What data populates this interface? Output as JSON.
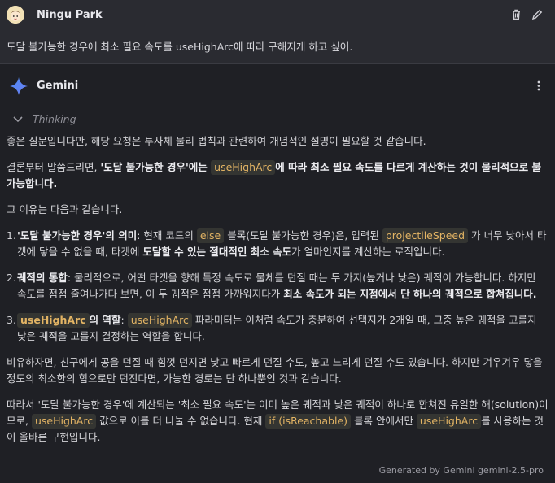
{
  "user": {
    "name": "Ningu Park",
    "message": "도달 불가능한 경우에 최소 필요 속도를 useHighArc에 따라 구해지게 하고 싶어.",
    "delete_icon": "trash-icon",
    "edit_icon": "pencil-icon"
  },
  "assistant": {
    "name": "Gemini",
    "thinking_label": "Thinking",
    "p1": "좋은 질문입니다만, 해당 요청은 투사체 물리 법칙과 관련하여 개념적인 설명이 필요할 것 같습니다.",
    "p2": {
      "t1": "결론부터 말씀드리면, ",
      "b1": "'도달 불가능한 경우'에는 ",
      "c1": "useHighArc",
      "b2": "에 따라 최소 필요 속도를 다르게 계산하는 것이 물리적으로 불가능합니다."
    },
    "p3": "그 이유는 다음과 같습니다.",
    "list": [
      {
        "num": "1.",
        "b1": "'도달 불가능한 경우'의 의미",
        "t1": ": 현재 코드의 ",
        "c1": "else",
        "t2": " 블록(도달 불가능한 경우)은, 입력된 ",
        "c2": "projectileSpeed",
        "t3": " 가 너무 낮아서 타겟에 닿을 수 없을 때, 타겟에 ",
        "b2": "도달할 수 있는 절대적인 최소 속도",
        "t4": "가 얼마인지를 계산하는 로직입니다."
      },
      {
        "num": "2.",
        "b1": "궤적의 통합",
        "t1": ": 물리적으로, 어떤 타겟을 향해 특정 속도로 물체를 던질 때는 두 가지(높거나 낮은) 궤적이 가능합니다. 하지만 속도를 점점 줄여나가다 보면, 이 두 궤적은 점점 가까워지다가 ",
        "b2": "최소 속도가 되는 지점에서 단 하나의 궤적으로 합쳐집니다."
      },
      {
        "num": "3.",
        "c1": "useHighArc",
        "b1": "의 역할",
        "t1": ": ",
        "c2": "useHighArc",
        "t2": " 파라미터는 이처럼 속도가 충분하여 선택지가 2개일 때, 그중 높은 궤적을 고를지 낮은 궤적을 고를지 결정하는 역할을 합니다."
      }
    ],
    "p4": "비유하자면, 친구에게 공을 던질 때 힘껏 던지면 낮고 빠르게 던질 수도, 높고 느리게 던질 수도 있습니다. 하지만 겨우겨우 닿을 정도의 최소한의 힘으로만 던진다면, 가능한 경로는 단 하나뿐인 것과 같습니다.",
    "p5": {
      "t1": "따라서 '도달 불가능한 경우'에 계산되는 '최소 필요 속도'는 이미 높은 궤적과 낮은 궤적이 하나로 합쳐진 유일한 해(solution)이므로, ",
      "c1": "useHighArc",
      "t2": " 값으로 이를 더 나눌 수 없습니다. 현재 ",
      "c2": "if (isReachable)",
      "t3": " 블록 안에서만 ",
      "c3": "useHighArc",
      "t4": "를 사용하는 것이 올바른 구현입니다."
    },
    "footer": "Generated by Gemini gemini-2.5-pro"
  }
}
